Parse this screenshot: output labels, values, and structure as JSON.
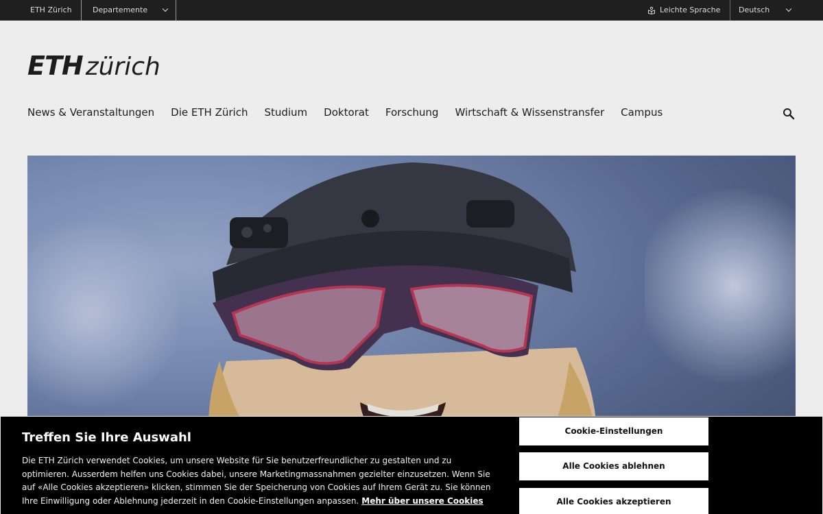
{
  "topbar": {
    "home": "ETH Zürich",
    "departments": "Departemente",
    "easy_language": "Leichte Sprache",
    "language": "Deutsch"
  },
  "logo": {
    "eth": "ETH",
    "zurich": "zürich"
  },
  "nav": {
    "items": [
      "News & Veranstaltungen",
      "Die ETH Zürich",
      "Studium",
      "Doktorat",
      "Forschung",
      "Wirtschaft & Wissenstransfer",
      "Campus"
    ]
  },
  "hero": {
    "icon": "person-with-mixed-reality-headset-photo"
  },
  "cookie": {
    "title": "Treffen Sie Ihre Auswahl",
    "text": "Die ETH Zürich verwendet Cookies, um unsere Website für Sie benutzerfreundlicher zu gestalten und zu optimieren. Ausserdem helfen uns Cookies dabei, unsere Marketingmassnahmen gezielter einzusetzen. Wenn Sie auf «Alle Cookies akzeptieren» klicken, stimmen Sie der Speicherung von Cookies auf Ihrem Gerät zu. Sie können Ihre Einwilligung oder Ablehnung jederzeit in den Cookie-Einstellungen anpassen.",
    "link": "Mehr über unsere Cookies",
    "btn_settings": "Cookie-Einstellungen",
    "btn_reject": "Alle Cookies ablehnen",
    "btn_accept": "Alle Cookies akzeptieren"
  },
  "colors": {
    "topbar": "#1f1f1f",
    "banner": "#000000",
    "text": "#1f1f1f"
  }
}
